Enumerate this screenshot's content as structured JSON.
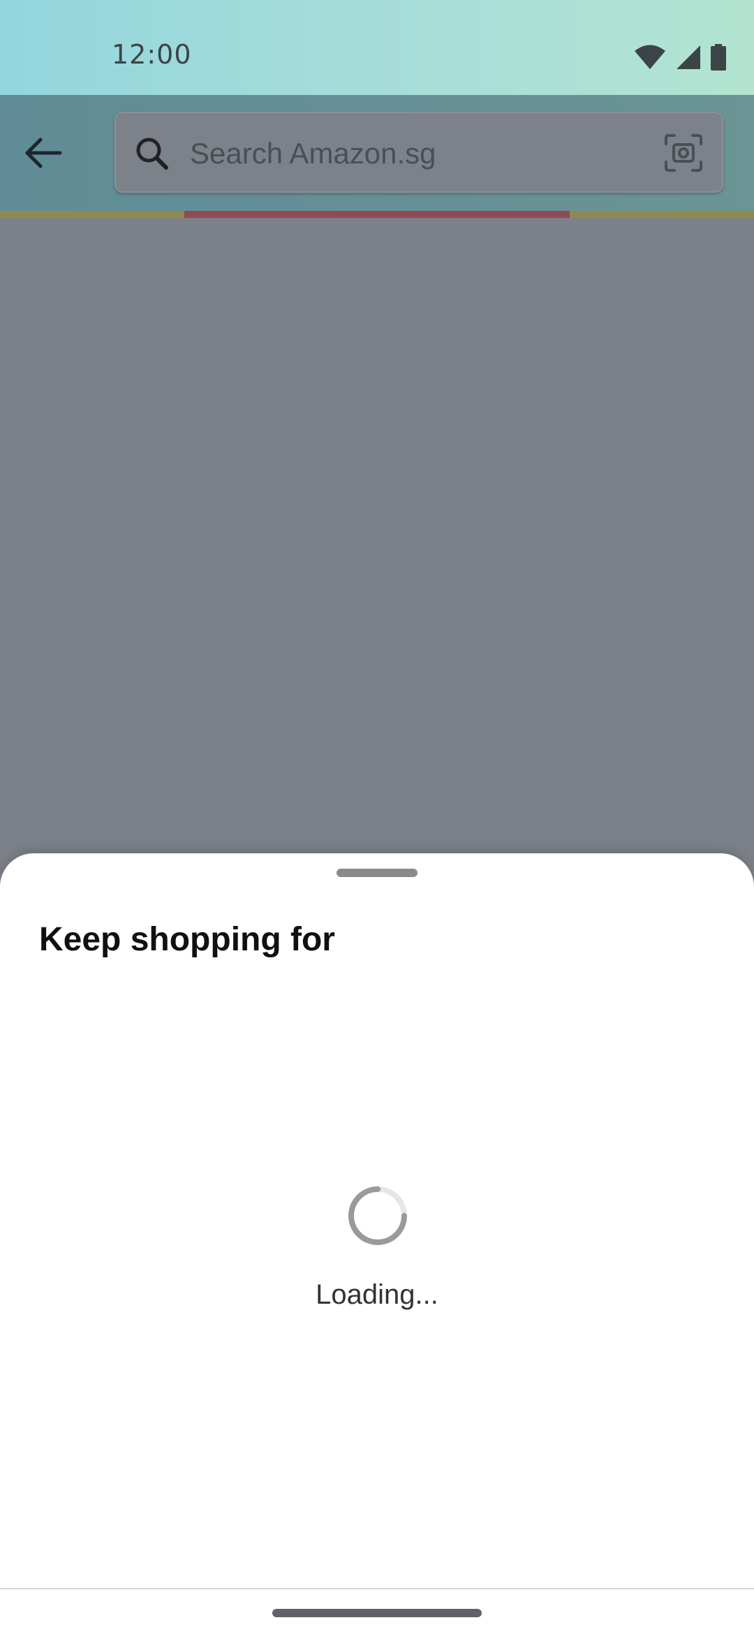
{
  "status_bar": {
    "time": "12:00",
    "icons": [
      "wifi-icon",
      "cellular-signal-icon",
      "battery-icon"
    ]
  },
  "toolbar": {
    "back_icon": "arrow-left-icon",
    "search": {
      "placeholder": "Search Amazon.sg",
      "left_icon": "search-icon",
      "right_icon": "camera-icon"
    }
  },
  "sheet": {
    "title": "Keep shopping for",
    "loading_text": "Loading..."
  },
  "colors": {
    "status_bar": "#a4dcda",
    "toolbar": "#668f97",
    "scrim_backdrop": "#7c8088",
    "progress_strip": "#8e8a4e",
    "progress_segment": "#8e4a55",
    "sheet_background": "#ffffff",
    "title_text": "#0f1111"
  }
}
